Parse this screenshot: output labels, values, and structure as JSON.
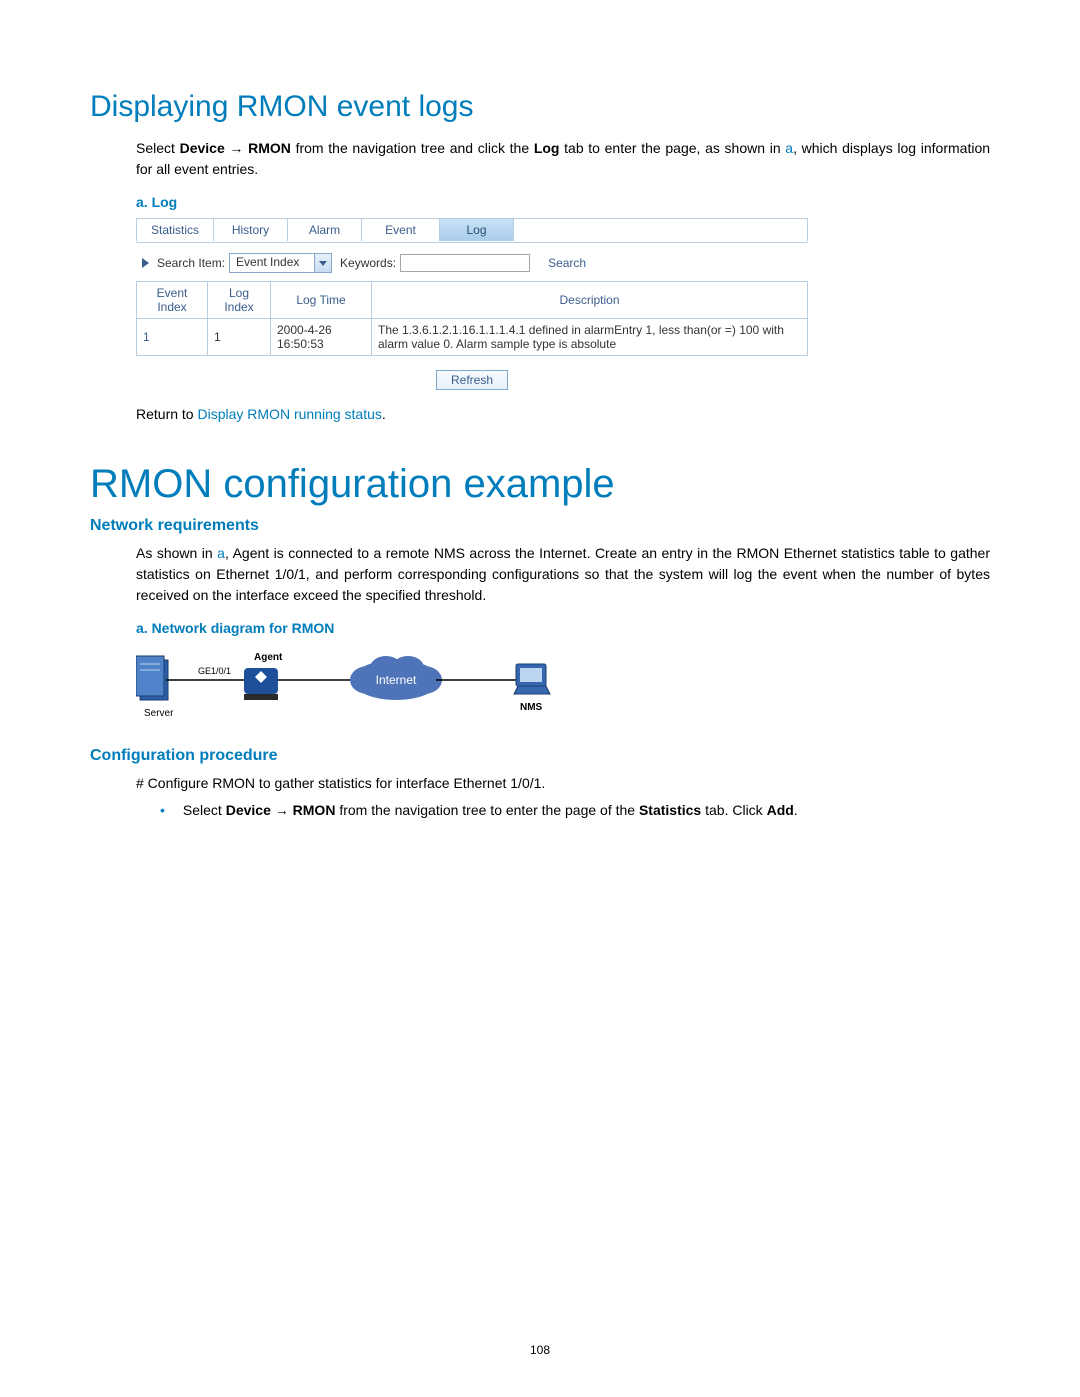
{
  "heading1": "Displaying RMON event logs",
  "para1_parts": {
    "pre": "Select ",
    "bold1": "Device",
    "arrow": " → ",
    "bold2": "RMON",
    "mid": " from the navigation tree and click the ",
    "bold3": "Log",
    "post": " tab to enter the page, as shown in ",
    "link": "a",
    "tail": ", which displays log information for all event entries."
  },
  "caption_a_log": "a.   Log",
  "tabs": {
    "t0": "Statistics",
    "t1": "History",
    "t2": "Alarm",
    "t3": "Event",
    "t4": "Log"
  },
  "search": {
    "label": "Search Item:",
    "dropdown_value": "Event Index",
    "kw_label": "Keywords:",
    "search_text": "Search"
  },
  "table": {
    "h0": "Event Index",
    "h1": "Log Index",
    "h2": "Log Time",
    "h3": "Description",
    "r0c0": "1",
    "r0c1": "1",
    "r0c2": "2000-4-26 16:50:53",
    "r0c3": "The 1.3.6.1.2.1.16.1.1.1.4.1 defined in alarmEntry 1, less than(or =) 100 with alarm value 0. Alarm sample type is absolute"
  },
  "refresh_label": "Refresh",
  "return_line": {
    "pre": "Return to ",
    "link": "Display RMON running status",
    "post": "."
  },
  "heading2": "RMON configuration example",
  "sub_netreq": "Network requirements",
  "para2_parts": {
    "pre": "As shown in ",
    "link": "a",
    "post": ", Agent is connected to a remote NMS across the Internet. Create an entry in the RMON Ethernet statistics table to gather statistics on Ethernet 1/0/1, and perform corresponding configurations so that the system will log the event when the number of bytes received on the interface exceed the specified threshold."
  },
  "caption_a_diagram": "a.   Network diagram for RMON",
  "diagram": {
    "agent": "Agent",
    "ge": "GE1/0/1",
    "server": "Server",
    "internet": "Internet",
    "nms": "NMS"
  },
  "sub_confproc": "Configuration procedure",
  "step_line": "# Configure RMON to gather statistics for interface Ethernet 1/0/1.",
  "bullet_parts": {
    "pre": "Select ",
    "bold1": "Device",
    "arrow": " → ",
    "bold2": "RMON",
    "mid": " from the navigation tree to enter the page of the ",
    "bold3": "Statistics",
    "post": " tab. Click ",
    "bold4": "Add",
    "end": "."
  },
  "page_number": "108"
}
